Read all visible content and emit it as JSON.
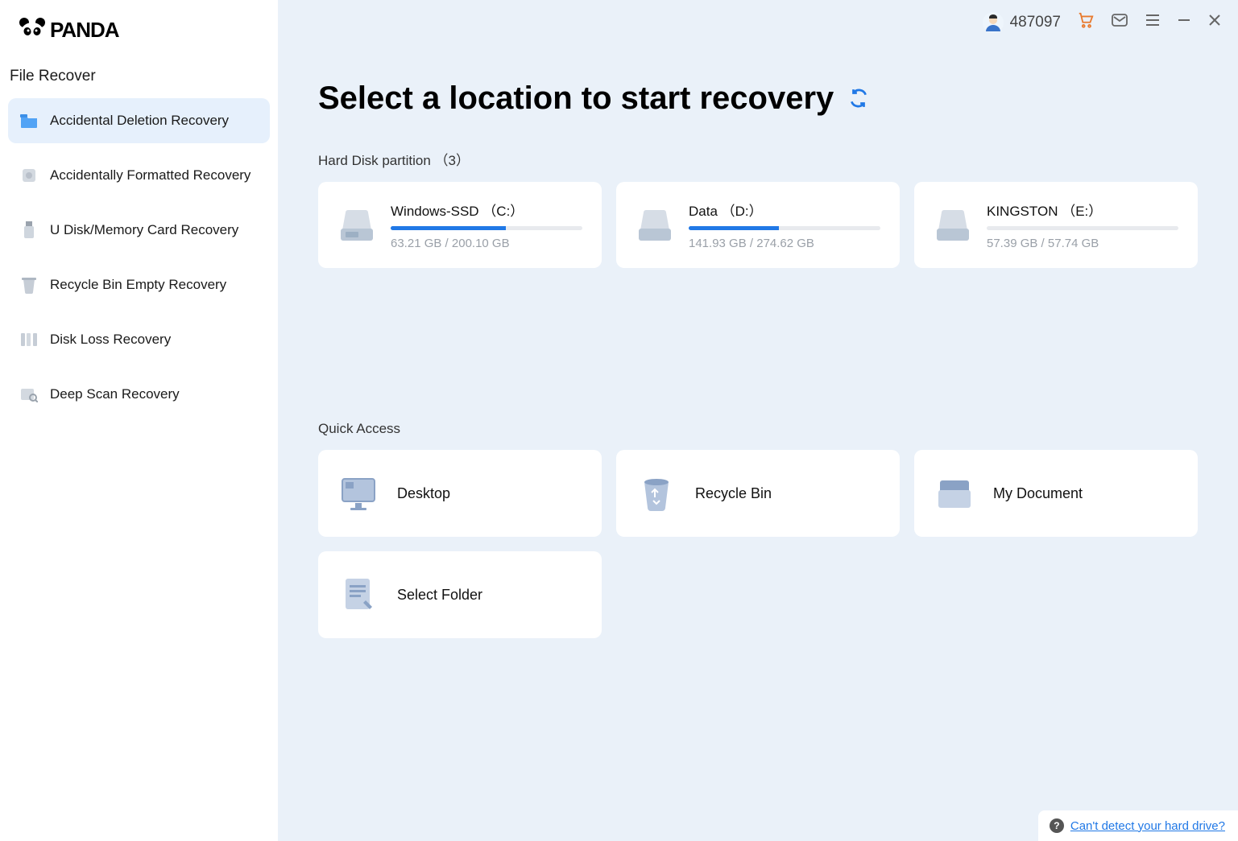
{
  "brand": "PANDA",
  "user_id": "487097",
  "sidebar": {
    "heading": "File Recover",
    "items": [
      {
        "label": "Accidental Deletion Recovery"
      },
      {
        "label": "Accidentally Formatted Recovery"
      },
      {
        "label": "U Disk/Memory Card Recovery"
      },
      {
        "label": "Recycle Bin Empty Recovery"
      },
      {
        "label": "Disk Loss Recovery"
      },
      {
        "label": "Deep Scan Recovery"
      }
    ]
  },
  "main": {
    "title": "Select a location to start recovery",
    "disk_section": "Hard Disk partition （3）",
    "disks": [
      {
        "name": "Windows-SSD （C:）",
        "usage": "63.21 GB / 200.10 GB",
        "percent": 60
      },
      {
        "name": "Data （D:）",
        "usage": "141.93 GB / 274.62 GB",
        "percent": 47
      },
      {
        "name": "KINGSTON （E:）",
        "usage": "57.39 GB / 57.74 GB",
        "percent": 0
      }
    ],
    "quick_section": "Quick Access",
    "quick": [
      {
        "label": "Desktop"
      },
      {
        "label": "Recycle Bin"
      },
      {
        "label": "My Document"
      },
      {
        "label": "Select Folder"
      }
    ]
  },
  "help_link": "Can't detect your hard drive?"
}
